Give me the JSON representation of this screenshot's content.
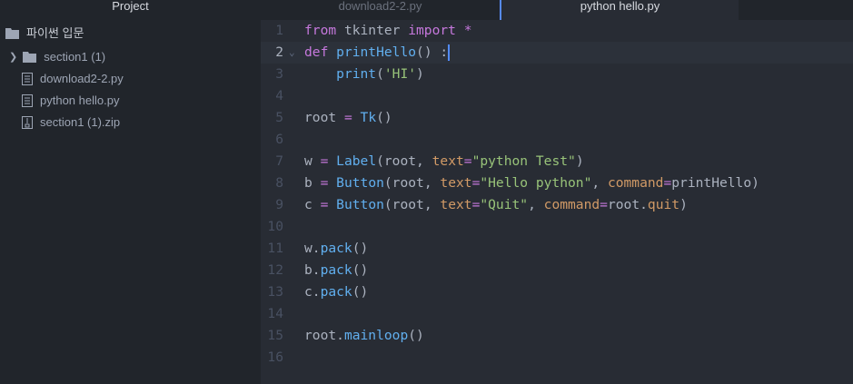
{
  "tabs": [
    {
      "label": "Project"
    },
    {
      "label": "download2-2.py"
    },
    {
      "label": "python hello.py"
    }
  ],
  "sidebar": {
    "root": "파이썬 입문",
    "items": [
      {
        "label": "section1 (1)",
        "icon": "folder-icon"
      },
      {
        "label": "download2-2.py",
        "icon": "file-text-icon"
      },
      {
        "label": "python hello.py",
        "icon": "file-text-icon"
      },
      {
        "label": "section1 (1).zip",
        "icon": "file-zip-icon"
      }
    ]
  },
  "editor": {
    "active_line": 2,
    "lines": [
      [
        [
          "from",
          "kw"
        ],
        [
          " tkinter ",
          "tx"
        ],
        [
          "import",
          "kw"
        ],
        [
          " ",
          "tx"
        ],
        [
          "*",
          "kw"
        ]
      ],
      [
        [
          "def",
          "kw"
        ],
        [
          " ",
          "tx"
        ],
        [
          "printHello",
          "fn"
        ],
        [
          "() :",
          "tx"
        ]
      ],
      [
        [
          "    ",
          "tx"
        ],
        [
          "print",
          "fn"
        ],
        [
          "(",
          "tx"
        ],
        [
          "'HI'",
          "st"
        ],
        [
          ")",
          "tx"
        ]
      ],
      [],
      [
        [
          "root ",
          "tx"
        ],
        [
          "=",
          "op"
        ],
        [
          " ",
          "tx"
        ],
        [
          "Tk",
          "fn"
        ],
        [
          "()",
          "tx"
        ]
      ],
      [],
      [
        [
          "w ",
          "tx"
        ],
        [
          "=",
          "op"
        ],
        [
          " ",
          "tx"
        ],
        [
          "Label",
          "fn"
        ],
        [
          "(root, ",
          "tx"
        ],
        [
          "text",
          "pa"
        ],
        [
          "=",
          "op"
        ],
        [
          "\"python Test\"",
          "st"
        ],
        [
          ")",
          "tx"
        ]
      ],
      [
        [
          "b ",
          "tx"
        ],
        [
          "=",
          "op"
        ],
        [
          " ",
          "tx"
        ],
        [
          "Button",
          "fn"
        ],
        [
          "(root, ",
          "tx"
        ],
        [
          "text",
          "pa"
        ],
        [
          "=",
          "op"
        ],
        [
          "\"Hello python\"",
          "st"
        ],
        [
          ", ",
          "tx"
        ],
        [
          "command",
          "pa"
        ],
        [
          "=",
          "op"
        ],
        [
          "printHello)",
          "tx"
        ]
      ],
      [
        [
          "c ",
          "tx"
        ],
        [
          "=",
          "op"
        ],
        [
          " ",
          "tx"
        ],
        [
          "Button",
          "fn"
        ],
        [
          "(root, ",
          "tx"
        ],
        [
          "text",
          "pa"
        ],
        [
          "=",
          "op"
        ],
        [
          "\"Quit\"",
          "st"
        ],
        [
          ", ",
          "tx"
        ],
        [
          "command",
          "pa"
        ],
        [
          "=",
          "op"
        ],
        [
          "root.",
          "tx"
        ],
        [
          "quit",
          "pa"
        ],
        [
          ")",
          "tx"
        ]
      ],
      [],
      [
        [
          "w.",
          "tx"
        ],
        [
          "pack",
          "fn"
        ],
        [
          "()",
          "tx"
        ]
      ],
      [
        [
          "b.",
          "tx"
        ],
        [
          "pack",
          "fn"
        ],
        [
          "()",
          "tx"
        ]
      ],
      [
        [
          "c.",
          "tx"
        ],
        [
          "pack",
          "fn"
        ],
        [
          "()",
          "tx"
        ]
      ],
      [],
      [
        [
          "root.",
          "tx"
        ],
        [
          "mainloop",
          "fn"
        ],
        [
          "()",
          "tx"
        ]
      ],
      []
    ]
  }
}
